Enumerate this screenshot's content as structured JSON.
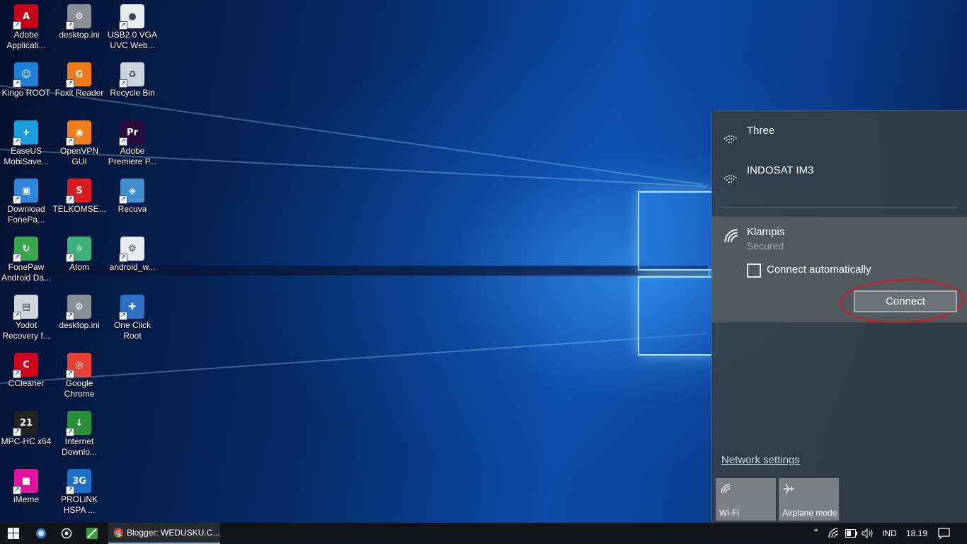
{
  "desktop": {
    "icons": [
      {
        "label": "Adobe\nApplicati...",
        "icon": "adobe-icon",
        "color": "#c8001a",
        "glyph": "A"
      },
      {
        "label": "desktop.ini",
        "icon": "settings-file-icon",
        "color": "#8a8f96",
        "glyph": "⚙"
      },
      {
        "label": "USB2.0 VGA\nUVC Web...",
        "icon": "webcam-icon",
        "color": "#e9ecef",
        "glyph": "●"
      },
      {
        "label": "Kingo ROOT",
        "icon": "kingo-root-icon",
        "color": "#1e7fd6",
        "glyph": "☺"
      },
      {
        "label": "Foxit Reader",
        "icon": "foxit-reader-icon",
        "color": "#f07a1a",
        "glyph": "G"
      },
      {
        "label": "Recycle Bin",
        "icon": "recycle-bin-icon",
        "color": "#c9d4de",
        "glyph": "♻"
      },
      {
        "label": "EaseUS\nMobiSave...",
        "icon": "easeus-icon",
        "color": "#1aa0e0",
        "glyph": "+"
      },
      {
        "label": "OpenVPN\nGUI",
        "icon": "openvpn-icon",
        "color": "#ef7f1a",
        "glyph": "◉"
      },
      {
        "label": "Adobe\nPremiere P...",
        "icon": "premiere-icon",
        "color": "#2a0a3a",
        "glyph": "Pr"
      },
      {
        "label": "Download\nFonePa...",
        "icon": "download-fonepaw-icon",
        "color": "#2f86d8",
        "glyph": "▣"
      },
      {
        "label": "TELKOMSE...",
        "icon": "telkomsel-icon",
        "color": "#d91b22",
        "glyph": "S"
      },
      {
        "label": "Recuva",
        "icon": "recuva-icon",
        "color": "#3f8fcf",
        "glyph": "◈"
      },
      {
        "label": "FonePaw\nAndroid Da...",
        "icon": "fonepaw-android-icon",
        "color": "#3aa64a",
        "glyph": "↻"
      },
      {
        "label": "Atom",
        "icon": "atom-icon",
        "color": "#3ab07a",
        "glyph": "⚛"
      },
      {
        "label": "android_w...",
        "icon": "settings-file-icon",
        "color": "#e8eaec",
        "glyph": "⚙"
      },
      {
        "label": "Yodot\nRecovery f...",
        "icon": "yodot-icon",
        "color": "#cfd6dc",
        "glyph": "▤"
      },
      {
        "label": "desktop.ini",
        "icon": "settings-file-icon",
        "color": "#8a8f96",
        "glyph": "⚙"
      },
      {
        "label": "One Click\nRoot",
        "icon": "one-click-root-icon",
        "color": "#2c6fc4",
        "glyph": "✚"
      },
      {
        "label": "CCleaner",
        "icon": "ccleaner-icon",
        "color": "#d0021b",
        "glyph": "C"
      },
      {
        "label": "Google\nChrome",
        "icon": "chrome-icon",
        "color": "#e94235",
        "glyph": "◎"
      },
      {
        "label": "",
        "icon": "",
        "color": "",
        "glyph": ""
      },
      {
        "label": "MPC-HC x64",
        "icon": "mpc-hc-icon",
        "color": "#222222",
        "glyph": "21"
      },
      {
        "label": "Internet\nDownlo...",
        "icon": "idm-icon",
        "color": "#2a8f3a",
        "glyph": "↓"
      },
      {
        "label": "",
        "icon": "",
        "color": "",
        "glyph": ""
      },
      {
        "label": "iMeme",
        "icon": "imeme-icon",
        "color": "#e0139f",
        "glyph": "■"
      },
      {
        "label": "PROLiNK\nHSPA ...",
        "icon": "prolink-icon",
        "color": "#1a6fc9",
        "glyph": "3G"
      }
    ]
  },
  "network_flyout": {
    "networks": [
      {
        "name": "Three",
        "status": ""
      },
      {
        "name": "INDOSAT IM3",
        "status": ""
      }
    ],
    "selected": {
      "name": "Klampis",
      "status": "Secured",
      "auto_connect_label": "Connect automatically",
      "auto_connect_checked": false,
      "connect_label": "Connect"
    },
    "settings_link": "Network settings",
    "quick_actions": [
      {
        "label": "Wi-Fi",
        "icon": "wifi-icon"
      },
      {
        "label": "Airplane mode",
        "icon": "airplane-icon"
      }
    ]
  },
  "taskbar": {
    "start_icon": "windows-start-icon",
    "pinned": [
      "cortana-icon",
      "task-view-icon",
      "app-icon"
    ],
    "active_app": {
      "label": "Blogger: WEDUSKU.C...",
      "icon": "chrome-icon"
    },
    "tray": {
      "language": "IND",
      "time": "18.19"
    }
  },
  "colors": {
    "flyout_bg": "#343e46",
    "accent_red": "#e0141e",
    "taskbar_bg": "#101418"
  }
}
